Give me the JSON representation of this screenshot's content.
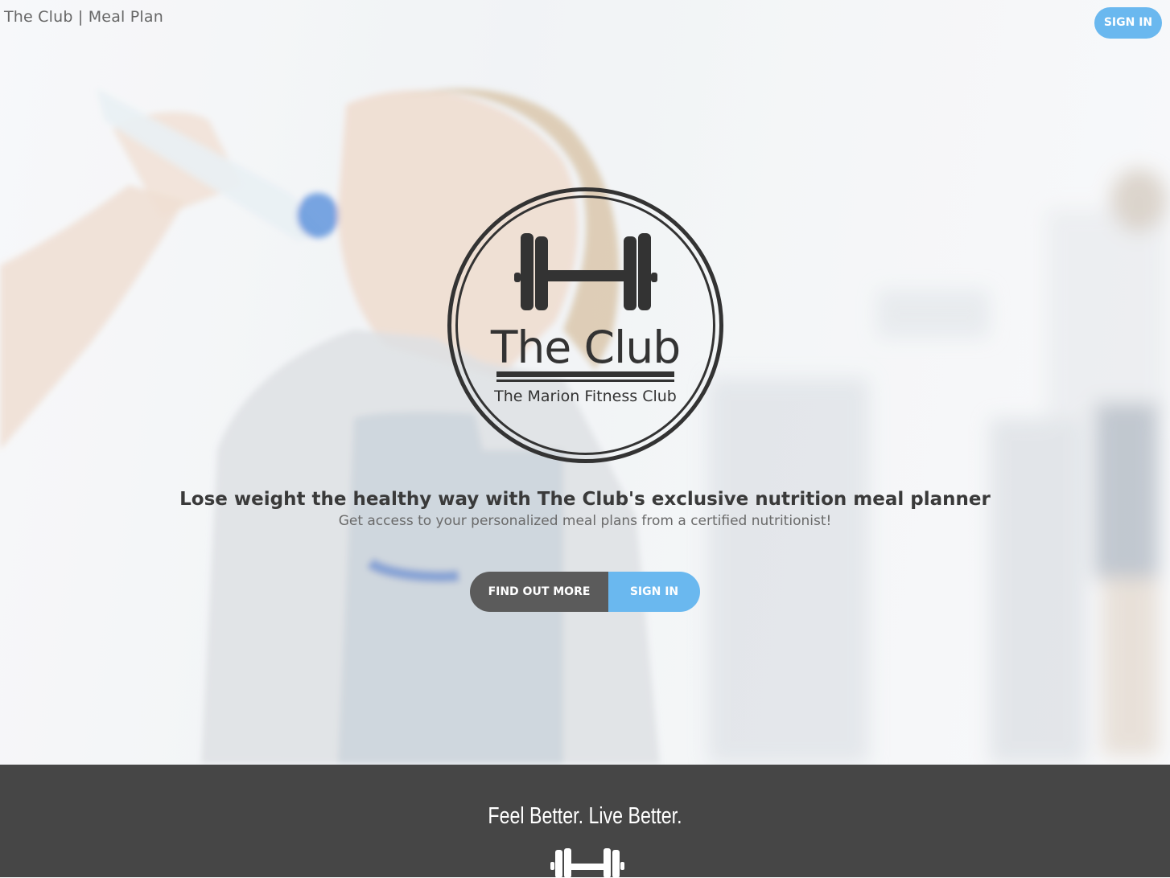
{
  "header": {
    "brand": "The Club | Meal Plan",
    "signin_label": "SIGN IN"
  },
  "logo": {
    "title": "The Club",
    "subtitle": "The Marion Fitness Club",
    "icon": "dumbbell-icon"
  },
  "hero": {
    "headline": "Lose weight the healthy way with The Club's exclusive nutrition meal planner",
    "subline": "Get access to your personalized meal plans from a certified nutritionist!",
    "find_out_more_label": "FIND OUT MORE",
    "signin_label": "SIGN IN"
  },
  "band": {
    "tagline": "Feel Better. Live Better.",
    "icon": "dumbbell-icon"
  },
  "colors": {
    "accent": "#6ab8ef",
    "dark_button": "#5b5b5b",
    "band_background": "#464646",
    "logo_ink": "#333333"
  }
}
